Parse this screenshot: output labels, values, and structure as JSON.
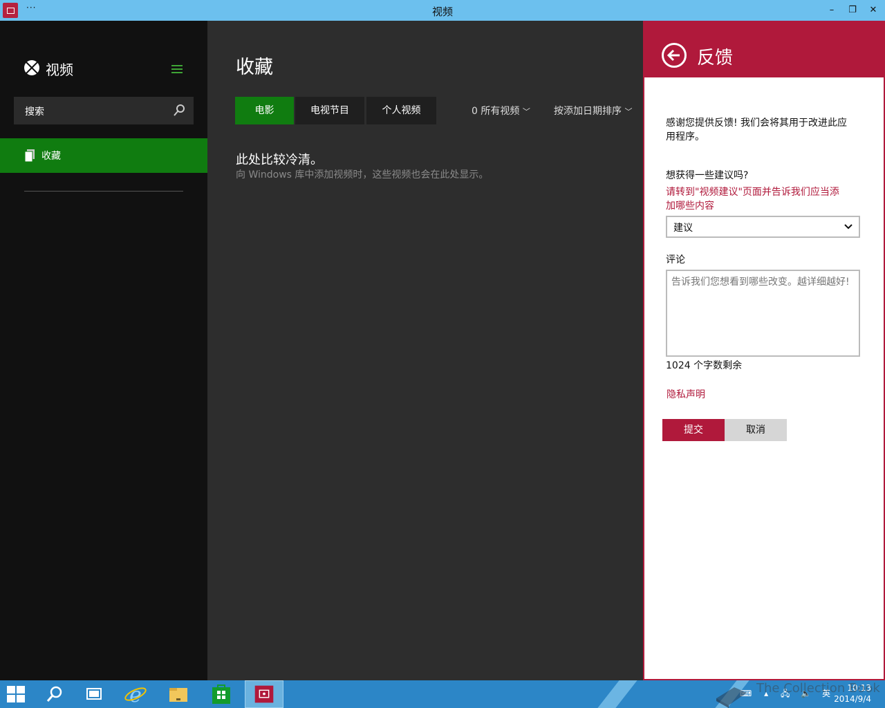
{
  "window": {
    "title": "视频",
    "menu_label": "···",
    "minimize": "–",
    "restore": "❐",
    "close": "✕"
  },
  "sidebar": {
    "app_name": "视频",
    "search_placeholder": "搜索",
    "items": [
      {
        "label": "收藏",
        "selected": true
      }
    ]
  },
  "main": {
    "title": "收藏",
    "tabs": [
      {
        "label": "电影",
        "active": true
      },
      {
        "label": "电视节目",
        "active": false
      },
      {
        "label": "个人视频",
        "active": false
      }
    ],
    "filter_label": "0 所有视频",
    "sort_label": "按添加日期排序",
    "empty_title": "此处比较冷清。",
    "empty_subtitle": "向 Windows 库中添加视频时，这些视频也会在此处显示。"
  },
  "feedback": {
    "title": "反馈",
    "thanks_line1": "感谢您提供反馈! 我们会将其用于改进此应",
    "thanks_line2": "用程序。",
    "suggest_question": "想获得一些建议吗?",
    "suggest_link_line1": "请转到\"视频建议\"页面并告诉我们应当添",
    "suggest_link_line2": "加哪些内容",
    "category_value": "建议",
    "comment_label": "评论",
    "comment_placeholder": "告诉我们您想看到哪些改变。越详细越好!",
    "char_count": "1024 个字数剩余",
    "privacy_link": "隐私声明",
    "submit_label": "提交",
    "cancel_label": "取消"
  },
  "taskbar": {
    "apps": [
      "search-icon",
      "task-view-icon",
      "internet-explorer-icon",
      "file-explorer-icon",
      "store-icon",
      "video-app-icon"
    ],
    "tray_ime": "英",
    "clock_time": "10:13",
    "clock_date": "2014/9/4"
  },
  "watermark": {
    "text": "The Collection Book"
  },
  "colors": {
    "accent_green": "#107c10",
    "accent_red": "#b0193b",
    "titlebar": "#6cc0ee",
    "taskbar": "#2c86c7"
  }
}
